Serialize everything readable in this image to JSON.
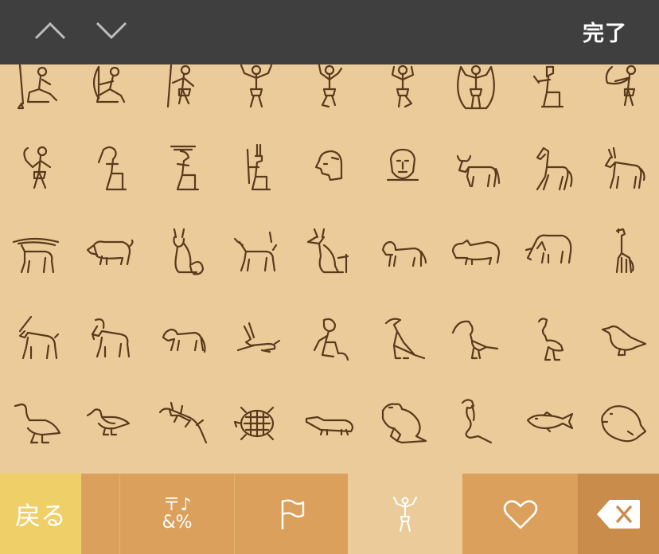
{
  "header": {
    "up_icon": "chevron-up-icon",
    "down_icon": "chevron-down-icon",
    "done_label": "完了"
  },
  "glyph_rows": [
    [
      "kneeling-man-with-staff",
      "kneeling-archer",
      "man-with-staff",
      "man-arms-raised",
      "dancing-man",
      "dancing-man-2",
      "man-with-rope",
      "seated-god",
      "man-with-fan"
    ],
    [
      "man-with-club",
      "ibis-headed-god",
      "god-with-feathers",
      "god-with-crown",
      "head-profile",
      "head-front",
      "bull",
      "horse",
      "donkey"
    ],
    [
      "ibex-long-horns",
      "pig",
      "seated-cat",
      "gazelle",
      "seated-jackal",
      "lion-cub",
      "hippopotamus",
      "elephant",
      "giraffe"
    ],
    [
      "oryx",
      "goat",
      "baboon",
      "hare",
      "seated-monkey",
      "vulture",
      "ibis",
      "flamingo",
      "small-bird"
    ],
    [
      "goose",
      "duck",
      "lizard",
      "turtle",
      "crocodile",
      "frog",
      "cobra",
      "fish",
      "pufferfish"
    ]
  ],
  "bottom_bar": {
    "back_label": "戻る",
    "symbols_label_line1": "〒♪",
    "symbols_label_line2": "&%",
    "flag_icon": "flag-icon",
    "people_icon": "person-icon",
    "heart_icon": "heart-icon",
    "delete_icon": "delete-icon"
  },
  "colors": {
    "topbar": "#3f3f3f",
    "background": "#ebcb99",
    "glyph_stroke": "#5a3a1c",
    "back_key": "#efd068",
    "tab": "#dba05c",
    "delete_key": "#c98c4a"
  }
}
